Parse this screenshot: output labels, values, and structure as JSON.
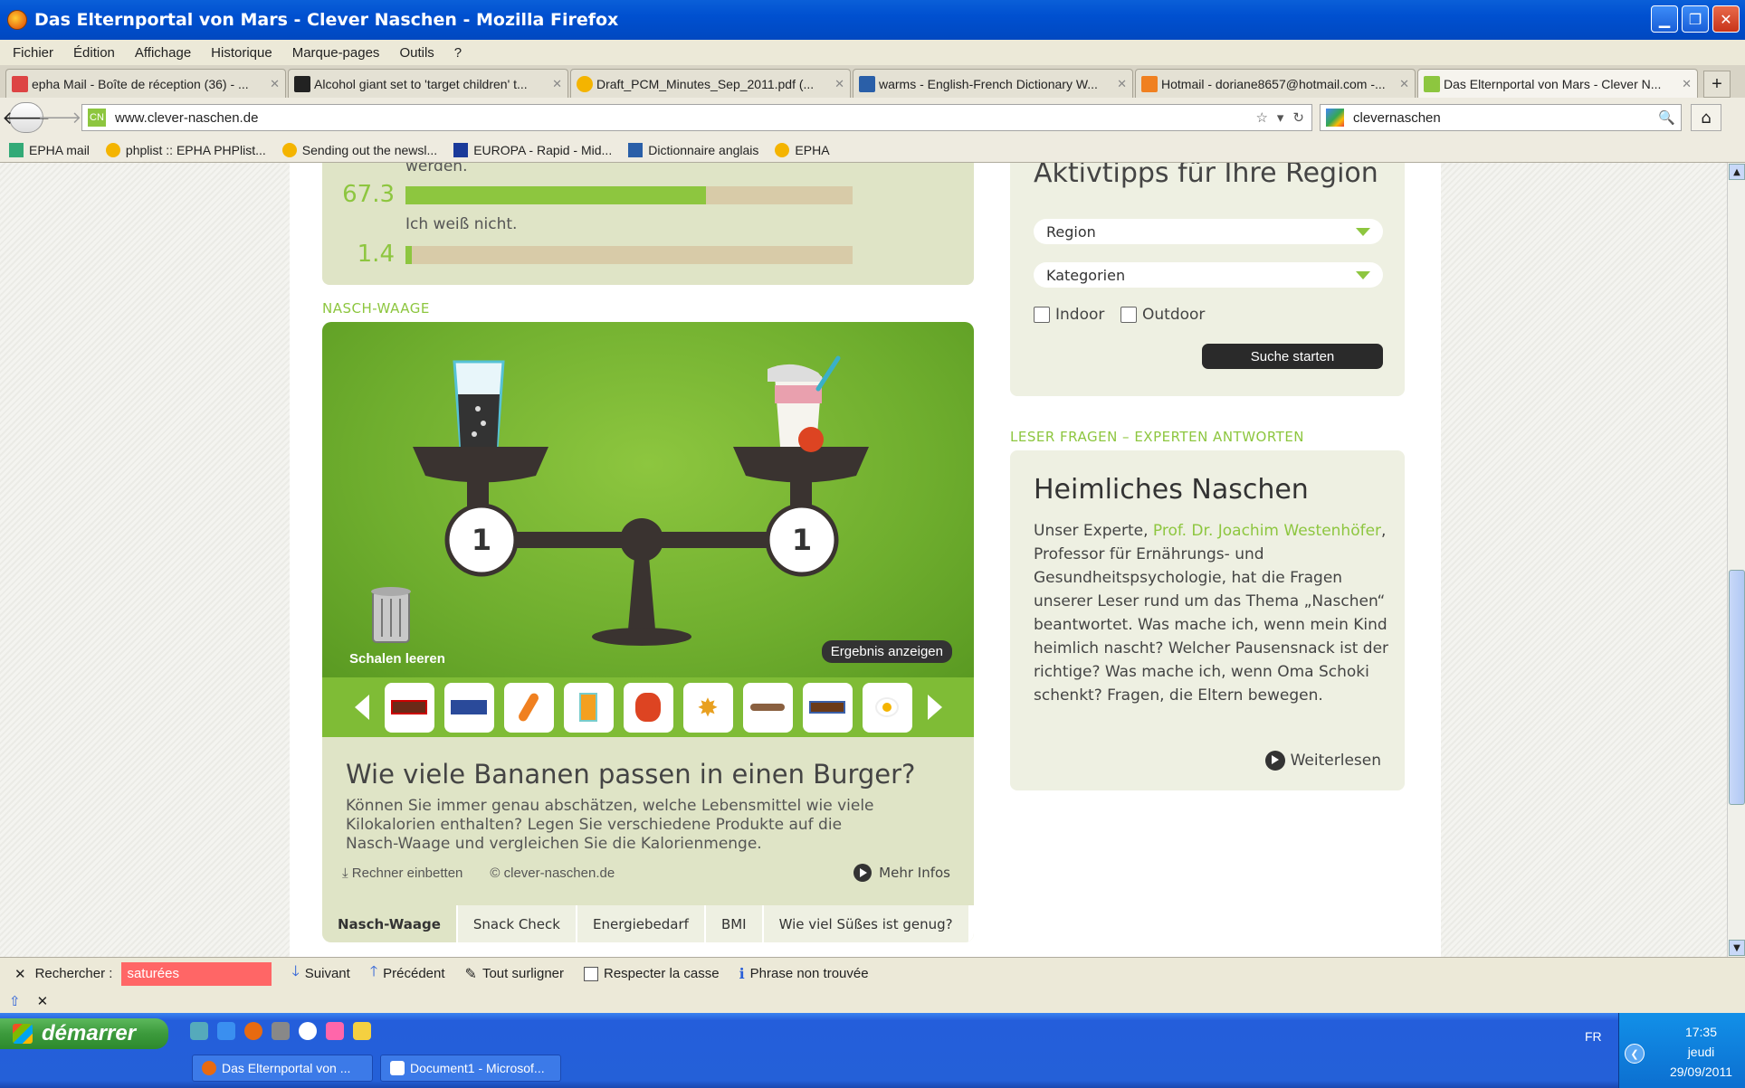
{
  "window": {
    "title": "Das Elternportal von Mars - Clever Naschen - Mozilla Firefox"
  },
  "menu": [
    "Fichier",
    "Édition",
    "Affichage",
    "Historique",
    "Marque-pages",
    "Outils",
    "?"
  ],
  "tabs": [
    {
      "label": "epha Mail - Boîte de réception (36) - ...",
      "icon": "gmail-icon",
      "color": "#d44"
    },
    {
      "label": "Alcohol giant set to 'target children' t...",
      "icon": "news-icon",
      "color": "#222"
    },
    {
      "label": "Draft_PCM_Minutes_Sep_2011.pdf (...",
      "icon": "sun-icon",
      "color": "#f4b400"
    },
    {
      "label": "warms - English-French Dictionary W...",
      "icon": "wr-icon",
      "color": "#2a5fa8"
    },
    {
      "label": "Hotmail - doriane8657@hotmail.com -...",
      "icon": "hotmail-icon",
      "color": "#f08020"
    },
    {
      "label": "Das Elternportal von Mars - Clever N...",
      "icon": "cn-icon",
      "color": "#8dc63f"
    }
  ],
  "nav": {
    "url": "www.clever-naschen.de",
    "search_value": "clevernaschen"
  },
  "bookmarks": [
    {
      "label": "EPHA mail",
      "icon": "people-icon",
      "color": "#3a7"
    },
    {
      "label": "phplist :: EPHA PHPlist...",
      "icon": "sun-icon",
      "color": "#f4b400"
    },
    {
      "label": "Sending out the newsl...",
      "icon": "sun-icon",
      "color": "#f4b400"
    },
    {
      "label": "EUROPA - Rapid - Mid...",
      "icon": "eu-icon",
      "color": "#1a3a9a"
    },
    {
      "label": "Dictionnaire anglais",
      "icon": "wr-icon",
      "color": "#2a5fa8"
    },
    {
      "label": "EPHA",
      "icon": "sun-icon",
      "color": "#f4b400"
    }
  ],
  "poll": {
    "partial_text": "werden.",
    "rows": [
      {
        "value": "67.3",
        "fraction": 0.673
      },
      {
        "label": "Ich weiß nicht.",
        "value": "1.4",
        "fraction": 0.014
      }
    ]
  },
  "nasch_waage": {
    "section_label": "NASCH-WAAGE",
    "left_count": "1",
    "right_count": "1",
    "clear_label": "Schalen leeren",
    "result_label": "Ergebnis anzeigen",
    "carousel_items": [
      "kinder-bar-icon",
      "milky-way-icon",
      "carrot-icon",
      "orange-juice-icon",
      "red-pepper-icon",
      "crisps-icon",
      "spoon-icon",
      "snickers-icon",
      "fried-egg-icon"
    ],
    "title": "Wie viele Bananen passen in einen Burger?",
    "description": "Können Sie immer genau abschätzen, welche Lebensmittel wie viele Kilokalorien enthalten? Legen Sie verschiedene Produkte auf die Nasch-Waage und vergleichen Sie die Kalorienmenge.",
    "embed_label": "⤓ Rechner einbetten",
    "copyright": "© clever-naschen.de",
    "more_label": "Mehr Infos",
    "tabs": [
      "Nasch-Waage",
      "Snack Check",
      "Energiebedarf",
      "BMI",
      "Wie viel Süßes ist genug?"
    ]
  },
  "sidebar": {
    "activity": {
      "title": "Aktivtipps für Ihre Region",
      "region_select": "Region",
      "category_select": "Kategorien",
      "indoor_label": "Indoor",
      "outdoor_label": "Outdoor",
      "search_button": "Suche starten"
    },
    "section_label": "LESER FRAGEN – EXPERTEN ANTWORTEN",
    "article": {
      "title": "Heimliches Naschen",
      "text_before": "Unser Experte, ",
      "link": "Prof. Dr. Joachim Westenhöfer",
      "text_after": ", Professor für Ernährungs- und Gesundheitspsychologie, hat die Fragen unserer Leser rund um das Thema „Naschen“ beantwortet. Was mache ich, wenn mein Kind heimlich nascht? Welcher Pausensnack ist der richtige? Was mache ich, wenn Oma Schoki schenkt? Fragen, die Eltern bewegen.",
      "more_label": "Weiterlesen"
    }
  },
  "findbar": {
    "label": "Rechercher :",
    "value": "saturées",
    "next": "Suivant",
    "prev": "Précédent",
    "highlight": "Tout surligner",
    "match_case": "Respecter la casse",
    "status": "Phrase non trouvée"
  },
  "taskbar": {
    "start": "démarrer",
    "buttons": [
      "Das Elternportal von ...",
      "Document1 - Microsof..."
    ],
    "lang": "FR",
    "time": "17:35",
    "day": "jeudi",
    "date": "29/09/2011"
  },
  "colors": {
    "brand_green": "#8dc63f",
    "xp_blue": "#245edb"
  }
}
